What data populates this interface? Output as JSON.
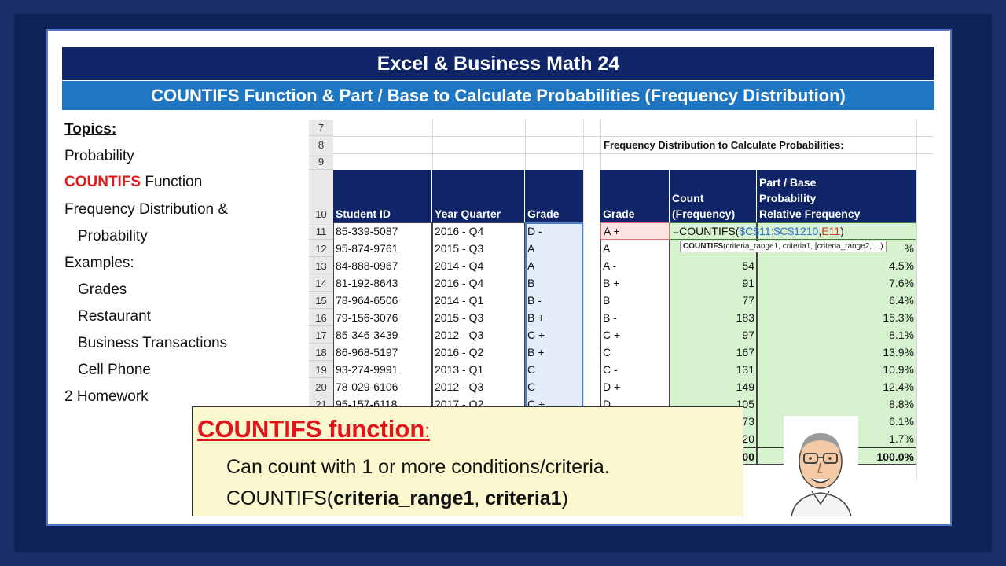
{
  "header": {
    "title": "Excel & Business Math 24",
    "subtitle": "COUNTIFS Function & Part / Base to Calculate Probabilities (Frequency Distribution)"
  },
  "topics": {
    "heading": "Topics:",
    "probability": "Probability",
    "countifs_red": "COUNTIFS",
    "countifs_rest": " Function",
    "freq1": "Frequency Distribution &",
    "freq2": "Probability",
    "examples": "Examples:",
    "grades": "Grades",
    "restaurant": "Restaurant",
    "business": "Business Transactions",
    "cell": "Cell Phone",
    "homework": "2 Homework"
  },
  "sheet": {
    "row_numbers": [
      "7",
      "8",
      "9",
      "10",
      "11",
      "12",
      "13",
      "14",
      "15",
      "16",
      "17",
      "18",
      "19",
      "20",
      "21"
    ],
    "freq_title": "Frequency Distribution to Calculate Probabilities:",
    "left_headers": {
      "id": "Student ID",
      "quarter": "Year Quarter",
      "grade": "Grade"
    },
    "right_headers": {
      "grade": "Grade",
      "count1": "Count",
      "count2": "(Frequency)",
      "pb1": "Part / Base",
      "pb2": "Probability",
      "pb3": "Relative Frequency"
    },
    "students": [
      {
        "id": "85-339-5087",
        "q": "2016 - Q4",
        "g": "D -"
      },
      {
        "id": "95-874-9761",
        "q": "2015 - Q3",
        "g": "A"
      },
      {
        "id": "84-888-0967",
        "q": "2014 - Q4",
        "g": "A"
      },
      {
        "id": "81-192-8643",
        "q": "2016 - Q4",
        "g": "B"
      },
      {
        "id": "78-964-6506",
        "q": "2014 - Q1",
        "g": "B -"
      },
      {
        "id": "79-156-3076",
        "q": "2015 - Q3",
        "g": "B +"
      },
      {
        "id": "85-346-3439",
        "q": "2012 - Q3",
        "g": "C +"
      },
      {
        "id": "86-968-5197",
        "q": "2016 - Q2",
        "g": "B +"
      },
      {
        "id": "93-274-9991",
        "q": "2013 - Q1",
        "g": "C"
      },
      {
        "id": "78-029-6106",
        "q": "2012 - Q3",
        "g": "C"
      },
      {
        "id": "95-157-6118",
        "q": "2017 - Q2",
        "g": "C +"
      }
    ],
    "freq_grades": [
      "A +",
      "A",
      "A -",
      "B +",
      "B",
      "B -",
      "C +",
      "C",
      "C -",
      "D +",
      "D"
    ],
    "counts": [
      "",
      "",
      "54",
      "91",
      "77",
      "183",
      "97",
      "167",
      "131",
      "149",
      "105",
      "73",
      "20",
      "00"
    ],
    "percents": [
      "",
      "%",
      "4.5%",
      "7.6%",
      "6.4%",
      "15.3%",
      "8.1%",
      "13.9%",
      "10.9%",
      "12.4%",
      "8.8%",
      "6.1%",
      "1.7%",
      "100.0%"
    ],
    "formula_prefix": "=COUNTIFS(",
    "formula_range": "$C$11:$C$1210",
    "formula_sep": ",",
    "formula_ref": "E11",
    "formula_end": ")",
    "tooltip_bold": "COUNTIFS",
    "tooltip_rest": "(criteria_range1, criteria1, [criteria_range2, ...)"
  },
  "callout": {
    "heading": "COUNTIFS function",
    "colon": ":",
    "line1": "Can count with 1 or more conditions/criteria.",
    "line2_prefix": "COUNTIFS(",
    "line2_arg1": "criteria_range1",
    "line2_sep": ", ",
    "line2_arg2": "criteria1",
    "line2_suffix": ")"
  },
  "colors": {
    "title_bg": "#0f2568",
    "subtitle_bg": "#1f77c4",
    "accent_red": "#e01a1a",
    "green_fill": "#d7f2cf",
    "callout_bg": "#fbf8cf"
  }
}
